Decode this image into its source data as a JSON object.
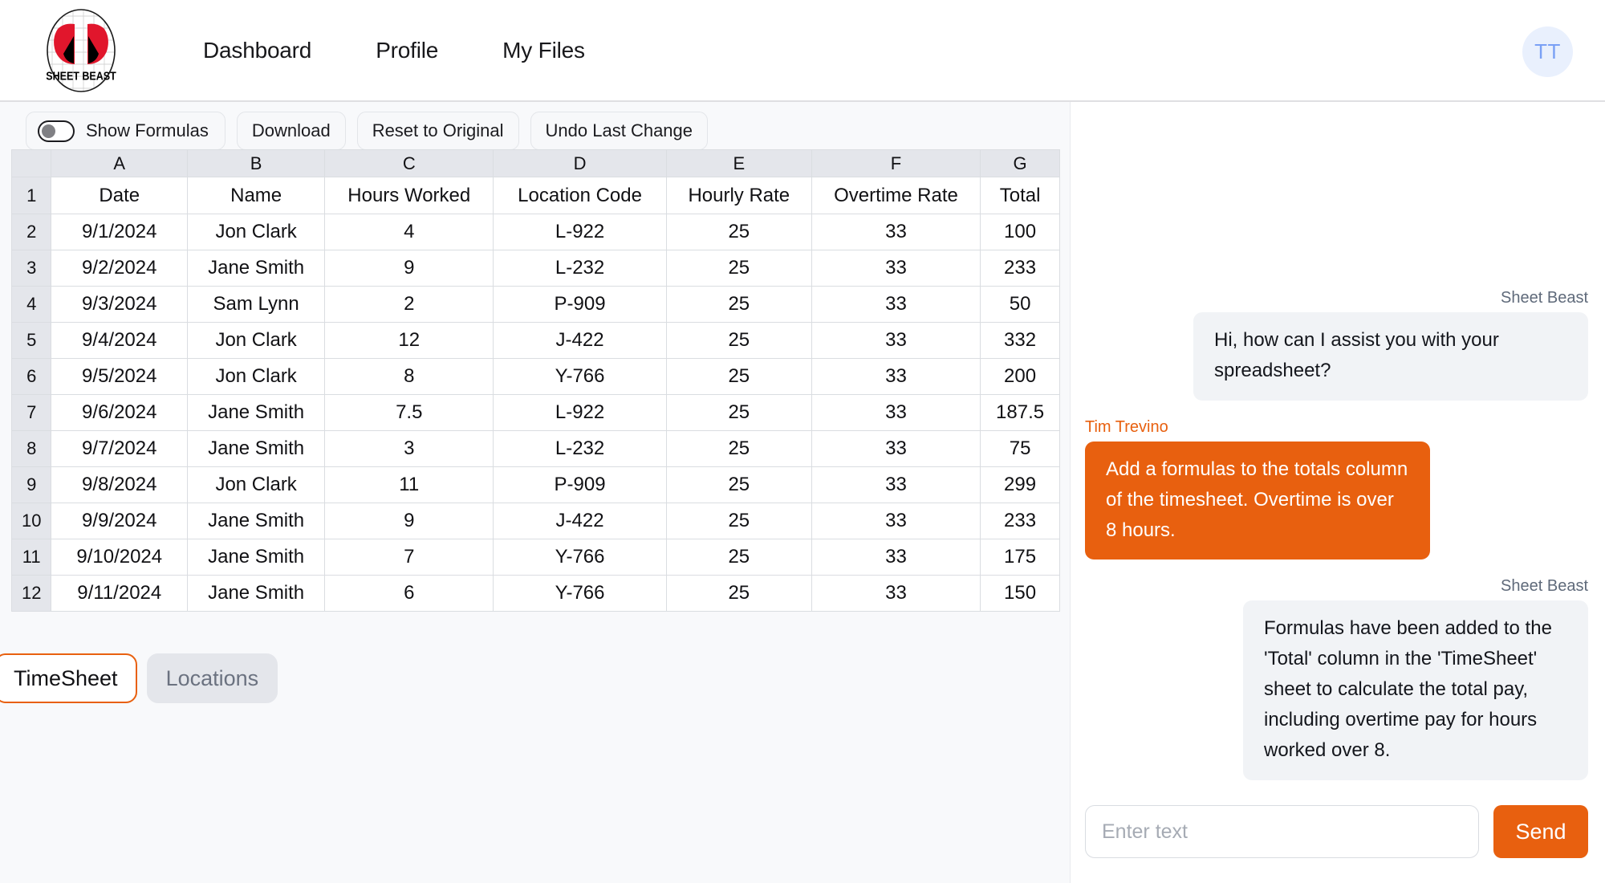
{
  "nav": {
    "logo_text": "SHEET BEAST",
    "links": [
      {
        "label": "Dashboard"
      },
      {
        "label": "Profile"
      },
      {
        "label": "My Files"
      }
    ],
    "avatar_initials": "TT"
  },
  "toolbar": {
    "show_formulas_label": "Show Formulas",
    "show_formulas_on": false,
    "download_label": "Download",
    "reset_label": "Reset to Original",
    "undo_label": "Undo Last Change"
  },
  "spreadsheet": {
    "column_letters": [
      "A",
      "B",
      "C",
      "D",
      "E",
      "F",
      "G"
    ],
    "rows": [
      {
        "n": "1",
        "cells": [
          "Date",
          "Name",
          "Hours Worked",
          "Location Code",
          "Hourly Rate",
          "Overtime Rate",
          "Total"
        ]
      },
      {
        "n": "2",
        "cells": [
          "9/1/2024",
          "Jon Clark",
          "4",
          "L-922",
          "25",
          "33",
          "100"
        ]
      },
      {
        "n": "3",
        "cells": [
          "9/2/2024",
          "Jane Smith",
          "9",
          "L-232",
          "25",
          "33",
          "233"
        ]
      },
      {
        "n": "4",
        "cells": [
          "9/3/2024",
          "Sam Lynn",
          "2",
          "P-909",
          "25",
          "33",
          "50"
        ]
      },
      {
        "n": "5",
        "cells": [
          "9/4/2024",
          "Jon Clark",
          "12",
          "J-422",
          "25",
          "33",
          "332"
        ]
      },
      {
        "n": "6",
        "cells": [
          "9/5/2024",
          "Jon Clark",
          "8",
          "Y-766",
          "25",
          "33",
          "200"
        ]
      },
      {
        "n": "7",
        "cells": [
          "9/6/2024",
          "Jane Smith",
          "7.5",
          "L-922",
          "25",
          "33",
          "187.5"
        ]
      },
      {
        "n": "8",
        "cells": [
          "9/7/2024",
          "Jane Smith",
          "3",
          "L-232",
          "25",
          "33",
          "75"
        ]
      },
      {
        "n": "9",
        "cells": [
          "9/8/2024",
          "Jon Clark",
          "11",
          "P-909",
          "25",
          "33",
          "299"
        ]
      },
      {
        "n": "10",
        "cells": [
          "9/9/2024",
          "Jane Smith",
          "9",
          "J-422",
          "25",
          "33",
          "233"
        ]
      },
      {
        "n": "11",
        "cells": [
          "9/10/2024",
          "Jane Smith",
          "7",
          "Y-766",
          "25",
          "33",
          "175"
        ]
      },
      {
        "n": "12",
        "cells": [
          "9/11/2024",
          "Jane Smith",
          "6",
          "Y-766",
          "25",
          "33",
          "150"
        ]
      }
    ]
  },
  "sheet_tabs": [
    {
      "label": "TimeSheet",
      "active": true
    },
    {
      "label": "Locations",
      "active": false
    }
  ],
  "chat": {
    "messages": [
      {
        "sender": "Sheet Beast",
        "role": "bot",
        "text": "Hi, how can I assist you with your spreadsheet?"
      },
      {
        "sender": "Tim Trevino",
        "role": "user",
        "text": "Add a formulas to the totals column of the timesheet. Overtime is over 8 hours."
      },
      {
        "sender": "Sheet Beast",
        "role": "bot",
        "text": "Formulas have been added to the 'Total' column in the 'TimeSheet' sheet to calculate the total pay, including overtime pay for hours worked over 8."
      }
    ],
    "input_placeholder": "Enter text",
    "input_value": "",
    "send_label": "Send"
  },
  "colors": {
    "accent_orange": "#e8600f",
    "header_gray": "#e4e6eb",
    "bubble_gray": "#f1f3f6",
    "avatar_bg": "#e9f0fd",
    "avatar_fg": "#7aa0f5"
  }
}
